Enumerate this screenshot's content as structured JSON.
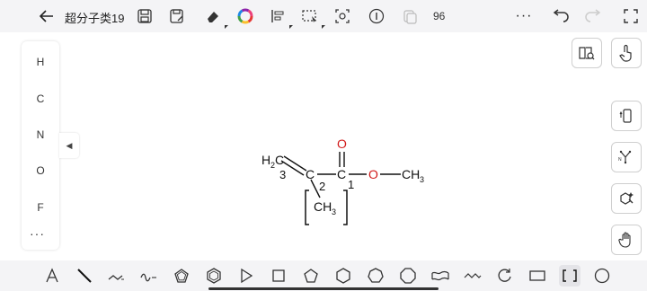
{
  "header": {
    "title": "超分子类19",
    "zoom": "96",
    "more": "···"
  },
  "left_palette": {
    "elements": [
      "H",
      "C",
      "N",
      "O",
      "F"
    ],
    "more": "···",
    "collapse_arrow": "◀"
  },
  "molecule": {
    "ch2_label": "H",
    "ch2_sub": "2",
    "ch2_c": "C",
    "atom_c": "C",
    "atom_c2": "C",
    "o_double": "O",
    "o_single": "O",
    "ch3_right": "CH",
    "ch3_right_sub": "3",
    "ch3_bottom": "CH",
    "ch3_bottom_sub": "3",
    "num_1": "1",
    "num_2": "2",
    "num_3": "3",
    "bracket_left": "[",
    "bracket_right": "]"
  },
  "colors": {
    "oxygen": "#d11a1a",
    "bond": "#111111",
    "accent": "#333333"
  },
  "icons": {
    "top": [
      "back-arrow-icon",
      "save-icon",
      "save-as-icon",
      "eraser-icon",
      "color-wheel-icon",
      "align-icon",
      "lasso-select-icon",
      "screenshot-icon",
      "info-icon",
      "copy-icon",
      "more-icon",
      "undo-icon",
      "redo-icon",
      "fullscreen-icon"
    ],
    "right": [
      "template-library-icon",
      "hand-gesture-icon",
      "rotate-device-icon",
      "chain-tool-icon",
      "ring-tool-icon",
      "pan-hand-icon"
    ],
    "bottom": [
      "text-tool-icon",
      "single-bond-icon",
      "chain-bond-icon",
      "wavy-bond-icon",
      "pentagon-ring-icon",
      "benzene-ring-icon",
      "triangle-shape-icon",
      "square-shape-icon",
      "pentagon-shape-icon",
      "hexagon-shape-icon",
      "heptagon-shape-icon",
      "octagon-shape-icon",
      "wave-shape-icon",
      "long-chain-icon",
      "refresh-circle-icon",
      "rectangle-shape-icon",
      "bracket-tool-icon",
      "circle-shape-icon"
    ]
  }
}
